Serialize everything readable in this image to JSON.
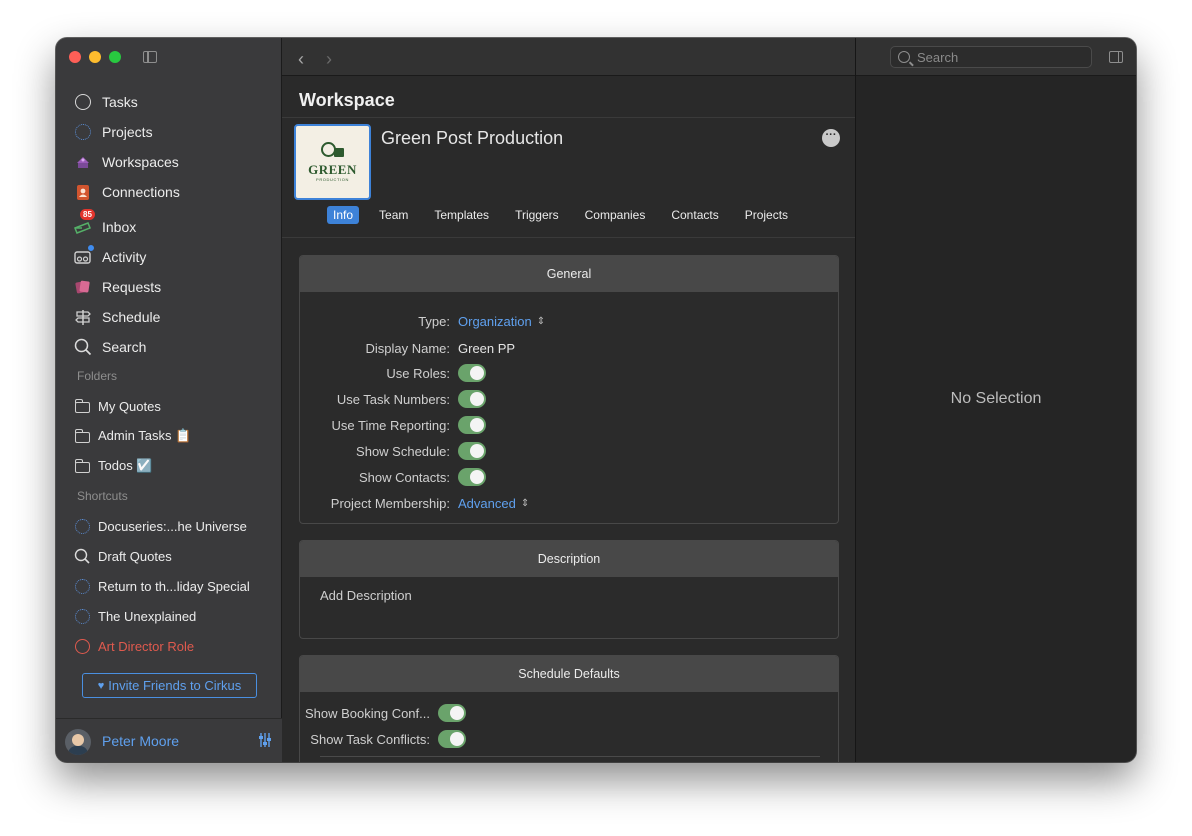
{
  "sidebar": {
    "nav": [
      {
        "label": "Tasks",
        "icon": "circle-icon"
      },
      {
        "label": "Projects",
        "icon": "dotted-circle-icon"
      },
      {
        "label": "Workspaces",
        "icon": "workspaces-icon"
      },
      {
        "label": "Connections",
        "icon": "contacts-book-icon"
      },
      {
        "label": "Inbox",
        "icon": "inbox-icon",
        "badge": "85"
      },
      {
        "label": "Activity",
        "icon": "activity-icon"
      },
      {
        "label": "Requests",
        "icon": "requests-icon"
      },
      {
        "label": "Schedule",
        "icon": "signpost-icon"
      },
      {
        "label": "Search",
        "icon": "search-icon"
      }
    ],
    "folders_label": "Folders",
    "folders": [
      {
        "label": "My Quotes",
        "icon": "folder-icon"
      },
      {
        "label": "Admin Tasks 📋",
        "icon": "folder-icon"
      },
      {
        "label": "Todos ☑️",
        "icon": "folder-icon"
      }
    ],
    "shortcuts_label": "Shortcuts",
    "shortcuts": [
      {
        "label": "Docuseries:...he Universe",
        "icon": "dotted-circle-icon"
      },
      {
        "label": "Draft Quotes",
        "icon": "search-icon"
      },
      {
        "label": "Return to th...liday Special",
        "icon": "dotted-circle-icon"
      },
      {
        "label": "The Unexplained",
        "icon": "dotted-circle-icon"
      },
      {
        "label": "Art Director Role",
        "icon": "circle-icon",
        "color": "#e05a4e"
      }
    ],
    "invite_label": "Invite Friends to Cirkus",
    "user_name": "Peter Moore"
  },
  "main": {
    "page_title": "Workspace",
    "workspace_name": "Green Post Production",
    "logo": {
      "word": "GREEN",
      "sub": "PRODUCTION"
    },
    "tabs": [
      "Info",
      "Team",
      "Templates",
      "Triggers",
      "Companies",
      "Contacts",
      "Projects"
    ],
    "active_tab": "Info",
    "general": {
      "title": "General",
      "type_label": "Type:",
      "type_value": "Organization",
      "display_name_label": "Display Name:",
      "display_name_value": "Green PP",
      "toggles": [
        {
          "label": "Use Roles:",
          "on": true
        },
        {
          "label": "Use Task Numbers:",
          "on": true
        },
        {
          "label": "Use Time Reporting:",
          "on": true
        },
        {
          "label": "Show Schedule:",
          "on": true
        },
        {
          "label": "Show Contacts:",
          "on": true
        }
      ],
      "membership_label": "Project Membership:",
      "membership_value": "Advanced"
    },
    "description": {
      "title": "Description",
      "placeholder": "Add Description"
    },
    "schedule_defaults": {
      "title": "Schedule Defaults",
      "toggles": [
        {
          "label": "Show Booking Conf...",
          "on": true
        },
        {
          "label": "Show Task Conflicts:",
          "on": true
        }
      ]
    }
  },
  "inspector": {
    "search_placeholder": "Search",
    "empty_text": "No Selection"
  },
  "colors": {
    "accent": "#3d82d8",
    "link": "#5fa0ee",
    "toggle_on": "#6aa36b",
    "danger": "#e05a4e"
  }
}
